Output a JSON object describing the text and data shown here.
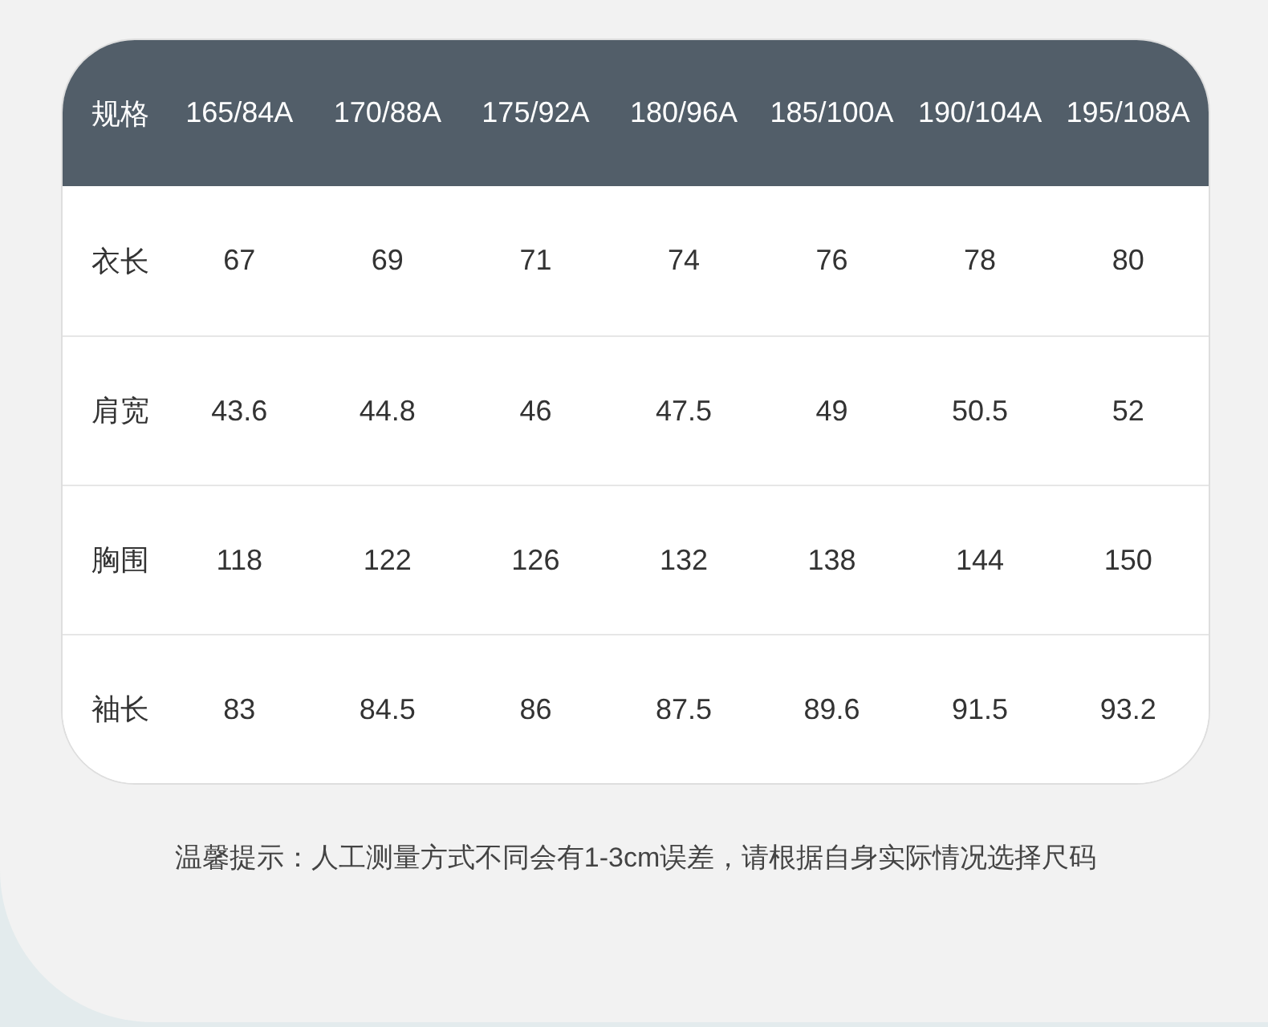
{
  "table": {
    "columns": [
      "规格",
      "165/84A",
      "170/88A",
      "175/92A",
      "180/96A",
      "185/100A",
      "190/104A",
      "195/108A"
    ],
    "rows": [
      [
        "衣长",
        "67",
        "69",
        "71",
        "74",
        "76",
        "78",
        "80"
      ],
      [
        "肩宽",
        "43.6",
        "44.8",
        "46",
        "47.5",
        "49",
        "50.5",
        "52"
      ],
      [
        "胸围",
        "118",
        "122",
        "126",
        "132",
        "138",
        "144",
        "150"
      ],
      [
        "袖长",
        "83",
        "84.5",
        "86",
        "87.5",
        "89.6",
        "91.5",
        "93.2"
      ]
    ]
  },
  "note": "温馨提示：人工测量方式不同会有1-3cm误差，请根据自身实际情况选择尺码"
}
